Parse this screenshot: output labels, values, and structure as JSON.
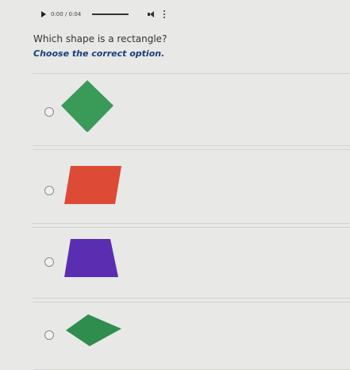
{
  "audio": {
    "time": "0:00 / 0:04"
  },
  "question": {
    "text": "Which shape is a rectangle?",
    "instruction": "Choose the correct option."
  },
  "options": [
    {
      "shape": "square rotated 45° (diamond)",
      "color": "#3a9a57"
    },
    {
      "shape": "parallelogram",
      "color": "#dd4a36"
    },
    {
      "shape": "trapezoid",
      "color": "#5b2db0"
    },
    {
      "shape": "kite",
      "color": "#2f8d4e"
    }
  ],
  "colors": {
    "question_text": "#333333",
    "instruction_text": "#1a3f7a",
    "background": "#e8e8e6"
  }
}
